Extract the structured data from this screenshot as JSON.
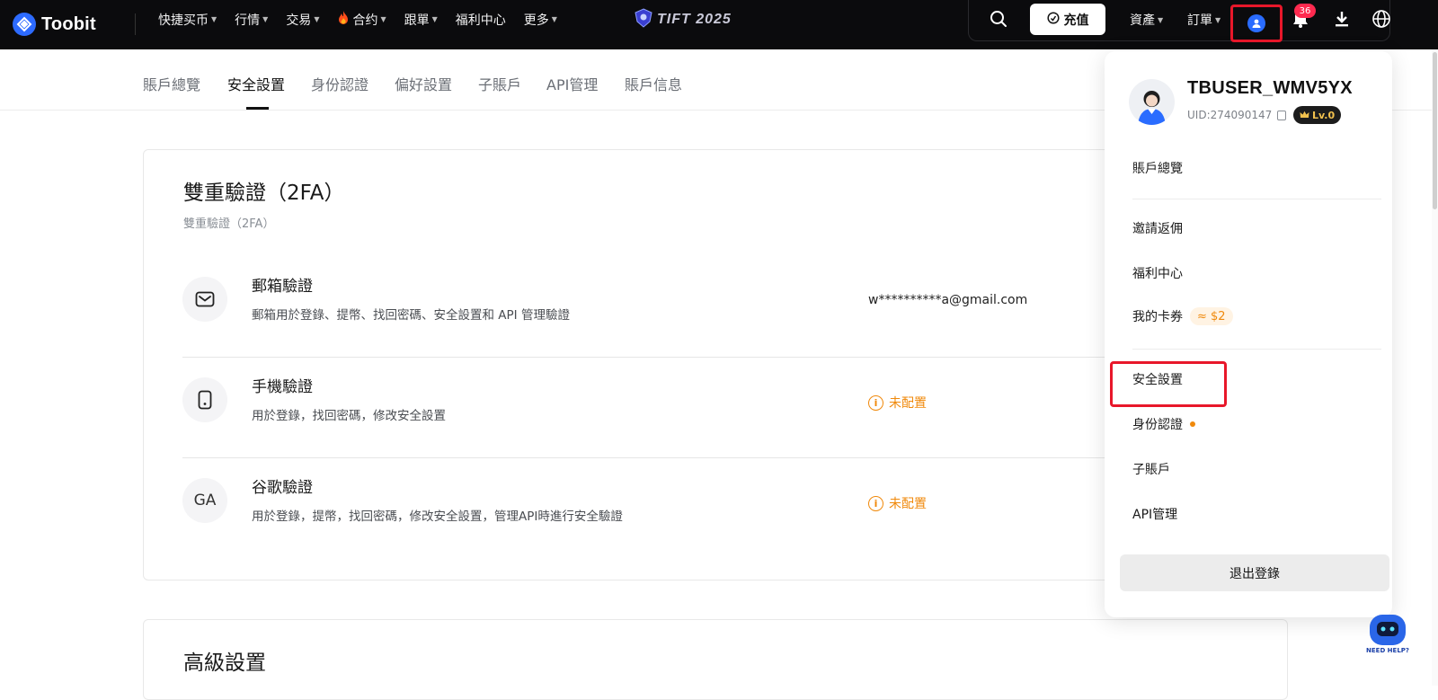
{
  "brand": {
    "name": "Toobit"
  },
  "nav": {
    "items": [
      {
        "label": "快捷买币",
        "has_caret": true
      },
      {
        "label": "行情",
        "has_caret": true
      },
      {
        "label": "交易",
        "has_caret": true
      },
      {
        "label": "合约",
        "has_caret": true,
        "icon": "fire-icon"
      },
      {
        "label": "跟單",
        "has_caret": true
      },
      {
        "label": "福利中心",
        "has_caret": false
      },
      {
        "label": "更多",
        "has_caret": true
      }
    ],
    "event_logo_text": "TIFT 2025"
  },
  "header_right": {
    "deposit_label": "充值",
    "assets_label": "資產",
    "orders_label": "訂單",
    "notification_count": "36"
  },
  "subtabs": [
    {
      "label": "賬戶總覽",
      "active": false
    },
    {
      "label": "安全設置",
      "active": true
    },
    {
      "label": "身份認證",
      "active": false
    },
    {
      "label": "偏好設置",
      "active": false
    },
    {
      "label": "子賬戶",
      "active": false
    },
    {
      "label": "API管理",
      "active": false
    },
    {
      "label": "賬戶信息",
      "active": false
    }
  ],
  "twofa": {
    "title": "雙重驗證（2FA）",
    "subtitle": "雙重驗證（2FA）",
    "rows": [
      {
        "icon": "mail-icon",
        "title": "郵箱驗證",
        "desc": "郵箱用於登錄、提幣、找回密碼、安全設置和 API 管理驗證",
        "value": "w**********a@gmail.com"
      },
      {
        "icon": "phone-icon",
        "title": "手機驗證",
        "desc": "用於登錄，找回密碼，修改安全設置",
        "status": "未配置"
      },
      {
        "icon": "ga-icon",
        "icon_text": "GA",
        "title": "谷歌驗證",
        "desc": "用於登錄，提幣，找回密碼，修改安全設置，管理API時進行安全驗證",
        "status": "未配置"
      }
    ]
  },
  "advanced": {
    "title": "高級設置"
  },
  "dropdown": {
    "username": "TBUSER_WMV5YX",
    "uid": "UID:274090147",
    "level": "Lv.0",
    "items": [
      {
        "label": "賬戶總覽"
      },
      {
        "label": "邀請返佣"
      },
      {
        "label": "福利中心"
      },
      {
        "label": "我的卡券",
        "coupon": "≈ $2"
      },
      {
        "label": "安全設置"
      },
      {
        "label": "身份認證"
      },
      {
        "label": "子賬戶"
      },
      {
        "label": "API管理"
      }
    ],
    "logout_label": "退出登錄"
  },
  "help": {
    "text": "NEED HELP?"
  },
  "colors": {
    "accent": "#2a6cff",
    "warning": "#f0890b",
    "badge": "#ff2a4f",
    "highlight": "#e8172a",
    "topbar": "#0b0b0d"
  }
}
